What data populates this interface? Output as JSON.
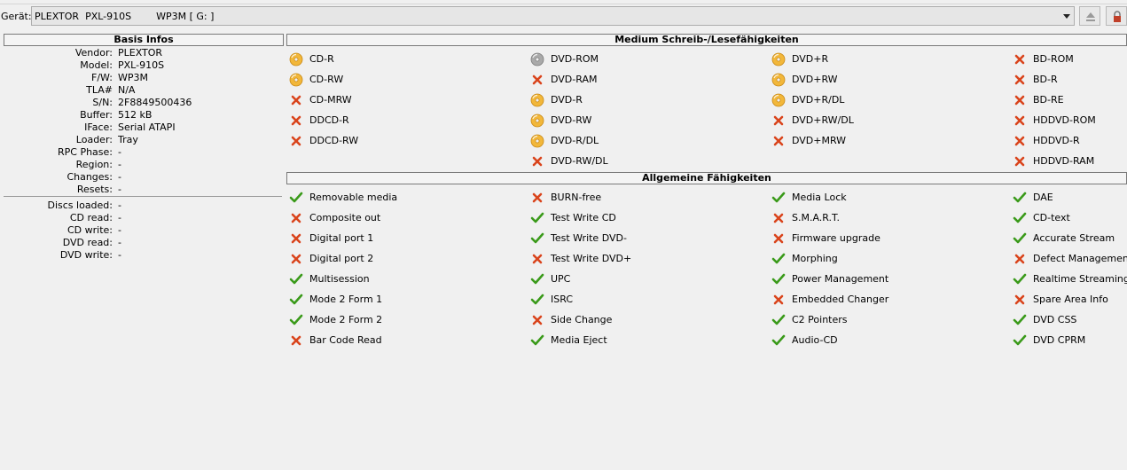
{
  "device": {
    "label": "Gerät:",
    "selected": "PLEXTOR  PXL-910S        WP3M [ G: ]"
  },
  "basis": {
    "title": "Basis Infos",
    "rows": [
      {
        "key": "Vendor:",
        "value": "PLEXTOR"
      },
      {
        "key": "Model:",
        "value": "PXL-910S"
      },
      {
        "key": "F/W:",
        "value": "WP3M"
      },
      {
        "key": "TLA#",
        "value": "N/A"
      },
      {
        "key": "S/N:",
        "value": "2F8849500436"
      },
      {
        "key": "Buffer:",
        "value": "512 kB"
      },
      {
        "key": "IFace:",
        "value": "Serial ATAPI"
      },
      {
        "key": "Loader:",
        "value": "Tray"
      },
      {
        "key": "RPC Phase:",
        "value": "-"
      },
      {
        "key": "Region:",
        "value": "-"
      },
      {
        "key": "Changes:",
        "value": "-"
      },
      {
        "key": "Resets:",
        "value": "-"
      }
    ],
    "stats": [
      {
        "key": "Discs loaded:",
        "value": "-"
      },
      {
        "key": "CD read:",
        "value": "-"
      },
      {
        "key": "CD write:",
        "value": "-"
      },
      {
        "key": "DVD read:",
        "value": "-"
      },
      {
        "key": "DVD write:",
        "value": "-"
      }
    ]
  },
  "media": {
    "title": "Medium Schreib-/Lesefähigkeiten",
    "columns": [
      [
        {
          "label": "CD-R",
          "status": "disc"
        },
        {
          "label": "CD-RW",
          "status": "disc"
        },
        {
          "label": "CD-MRW",
          "status": "no"
        },
        {
          "label": "DDCD-R",
          "status": "no"
        },
        {
          "label": "DDCD-RW",
          "status": "no"
        }
      ],
      [
        {
          "label": "DVD-ROM",
          "status": "disc-read"
        },
        {
          "label": "DVD-RAM",
          "status": "no"
        },
        {
          "label": "DVD-R",
          "status": "disc"
        },
        {
          "label": "DVD-RW",
          "status": "disc"
        },
        {
          "label": "DVD-R/DL",
          "status": "disc"
        },
        {
          "label": "DVD-RW/DL",
          "status": "no"
        }
      ],
      [
        {
          "label": "DVD+R",
          "status": "disc"
        },
        {
          "label": "DVD+RW",
          "status": "disc"
        },
        {
          "label": "DVD+R/DL",
          "status": "disc"
        },
        {
          "label": "DVD+RW/DL",
          "status": "no"
        },
        {
          "label": "DVD+MRW",
          "status": "no"
        }
      ],
      [
        {
          "label": "BD-ROM",
          "status": "no"
        },
        {
          "label": "BD-R",
          "status": "no"
        },
        {
          "label": "BD-RE",
          "status": "no"
        },
        {
          "label": "HDDVD-ROM",
          "status": "no"
        },
        {
          "label": "HDDVD-R",
          "status": "no"
        },
        {
          "label": "HDDVD-RAM",
          "status": "no"
        }
      ]
    ]
  },
  "general": {
    "title": "Allgemeine Fähigkeiten",
    "columns": [
      [
        {
          "label": "Removable media",
          "status": "yes"
        },
        {
          "label": "Composite out",
          "status": "no"
        },
        {
          "label": "Digital port 1",
          "status": "no"
        },
        {
          "label": "Digital port 2",
          "status": "no"
        },
        {
          "label": "Multisession",
          "status": "yes"
        },
        {
          "label": "Mode 2 Form 1",
          "status": "yes"
        },
        {
          "label": "Mode 2 Form 2",
          "status": "yes"
        },
        {
          "label": "Bar Code Read",
          "status": "no"
        }
      ],
      [
        {
          "label": "BURN-free",
          "status": "no"
        },
        {
          "label": "Test Write CD",
          "status": "yes"
        },
        {
          "label": "Test Write DVD-",
          "status": "yes"
        },
        {
          "label": "Test Write DVD+",
          "status": "no"
        },
        {
          "label": "UPC",
          "status": "yes"
        },
        {
          "label": "ISRC",
          "status": "yes"
        },
        {
          "label": "Side Change",
          "status": "no"
        },
        {
          "label": "Media Eject",
          "status": "yes"
        }
      ],
      [
        {
          "label": "Media Lock",
          "status": "yes"
        },
        {
          "label": "S.M.A.R.T.",
          "status": "no"
        },
        {
          "label": "Firmware upgrade",
          "status": "no"
        },
        {
          "label": "Morphing",
          "status": "yes"
        },
        {
          "label": "Power Management",
          "status": "yes"
        },
        {
          "label": "Embedded Changer",
          "status": "no"
        },
        {
          "label": "C2 Pointers",
          "status": "yes"
        },
        {
          "label": "Audio-CD",
          "status": "yes"
        }
      ],
      [
        {
          "label": "DAE",
          "status": "yes"
        },
        {
          "label": "CD-text",
          "status": "yes"
        },
        {
          "label": "Accurate Stream",
          "status": "yes"
        },
        {
          "label": "Defect Management",
          "status": "no"
        },
        {
          "label": "Realtime Streaming",
          "status": "yes"
        },
        {
          "label": "Spare Area Info",
          "status": "no"
        },
        {
          "label": "DVD CSS",
          "status": "yes"
        },
        {
          "label": "DVD CPRM",
          "status": "yes"
        }
      ]
    ]
  },
  "colors": {
    "yes": "#3a9a1a",
    "no": "#d9441c",
    "disc": "#f2b73a",
    "disc_read": "#a9a9a9"
  }
}
